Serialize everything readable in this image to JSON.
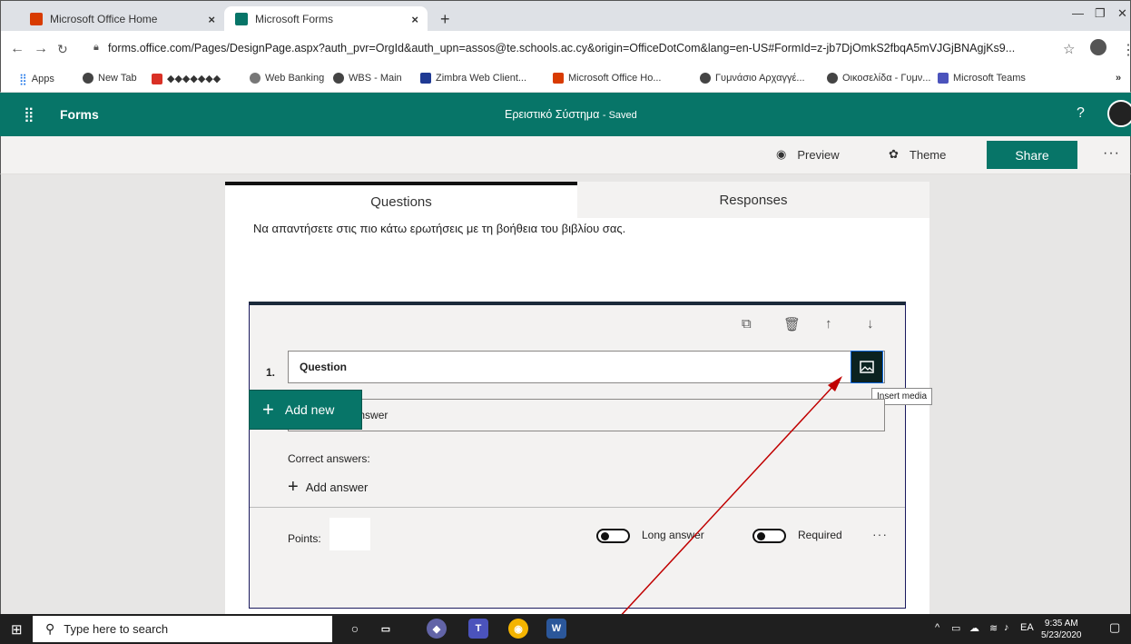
{
  "browser": {
    "tabs": [
      {
        "title": "Microsoft Office Home"
      },
      {
        "title": "Microsoft Forms"
      }
    ],
    "new_tab": "+",
    "url": "forms.office.com/Pages/DesignPage.aspx?auth_pvr=OrgId&auth_upn=assos@te.schools.ac.cy&origin=OfficeDotCom&lang=en-US#FormId=z-jb7DjOmkS2fbqA5mVJGjBNAgjKs9...",
    "bookmarks": [
      "Apps",
      "New Tab",
      "◆◆◆◆◆◆◆",
      "Web Banking",
      "WBS - Main",
      "Zimbra Web Client...",
      "Microsoft Office Ho...",
      "Γυμνάσιο Αρχαγγέ...",
      "Οικοσελίδα - Γυμν...",
      "Microsoft Teams"
    ]
  },
  "forms": {
    "brand": "Forms",
    "form_title": "Ερειστικό Σύστημα",
    "saved_status": "- Saved",
    "help": "?"
  },
  "toolbar": {
    "preview": "Preview",
    "theme": "Theme",
    "share": "Share",
    "more": "···"
  },
  "editor": {
    "tabs": {
      "questions": "Questions",
      "responses": "Responses"
    },
    "subtitle": "Να απαντήσετε στις πιο κάτω ερωτήσεις με τη βοήθεια του βιβλίου σας.",
    "question": {
      "number": "1.",
      "value": "Question",
      "answer_placeholder": "Enter your answer",
      "correct_answers_label": "Correct answers:",
      "add_answer": "Add answer",
      "points_label": "Points:",
      "long_answer": "Long answer",
      "required": "Required",
      "more": "···",
      "tooltip": "Insert media"
    },
    "add_new": "Add new"
  },
  "taskbar": {
    "search_placeholder": "Type here to search",
    "language": "EA",
    "time": "9:35 AM",
    "date": "5/23/2020"
  },
  "colors": {
    "accent": "#077568",
    "arrow": "#c00000"
  }
}
